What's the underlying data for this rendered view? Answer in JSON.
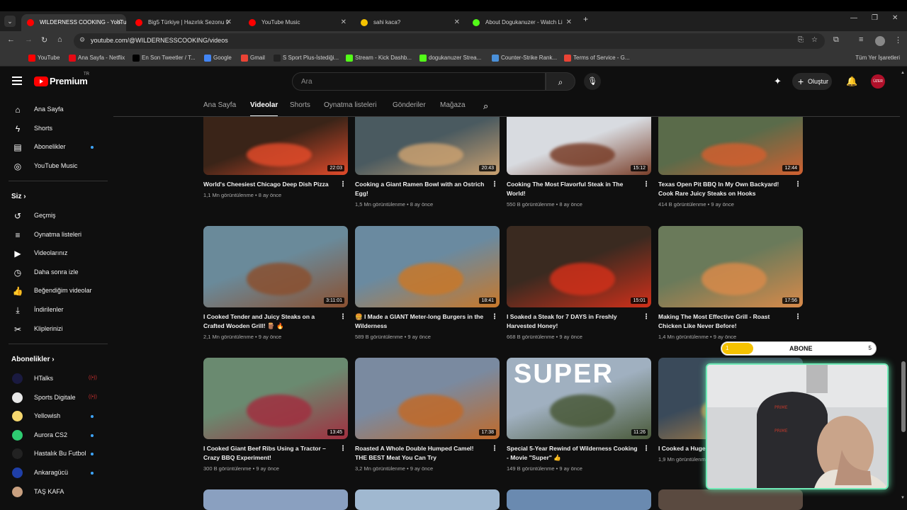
{
  "browser": {
    "tabs": [
      {
        "title": "WILDERNESS COOKING - YouTube",
        "color": "#ff0000",
        "active": true
      },
      {
        "title": "Big5 Türkiye | Hazırlık Sezonu 9",
        "color": "#ff0000",
        "active": false
      },
      {
        "title": "YouTube Music",
        "color": "#ff0000",
        "active": false
      },
      {
        "title": "sahi kaca?",
        "color": "#f5c200",
        "active": false
      },
      {
        "title": "About Dogukanuzer - Watch Li",
        "color": "#53fc18",
        "active": false
      }
    ],
    "url": "youtube.com/@WILDERNESSCOOKING/videos",
    "bookmarks": [
      {
        "label": "YouTube",
        "color": "#ff0000"
      },
      {
        "label": "Ana Sayfa - Netflix",
        "color": "#e50914"
      },
      {
        "label": "En Son Tweetler / T...",
        "color": "#000000"
      },
      {
        "label": "Google",
        "color": "#4285f4"
      },
      {
        "label": "Gmail",
        "color": "#ea4335"
      },
      {
        "label": "S Sport Plus-İstediği...",
        "color": "#222222"
      },
      {
        "label": "Stream - Kick Dashb...",
        "color": "#53fc18"
      },
      {
        "label": "dogukanuzer Strea...",
        "color": "#53fc18"
      },
      {
        "label": "Counter-Strike Rank...",
        "color": "#4a90d9"
      },
      {
        "label": "Terms of Service - G...",
        "color": "#ea4335"
      }
    ],
    "all_bookmarks": "Tüm Yer İşaretleri"
  },
  "header": {
    "logo": "Premium",
    "logo_sup": "TR",
    "search_placeholder": "Ara",
    "create_label": "Oluştur",
    "avatar_text": "ÜZER"
  },
  "sidebar": {
    "main": [
      {
        "label": "Ana Sayfa",
        "icon": "home-icon",
        "glyph": "⌂",
        "dot": false
      },
      {
        "label": "Shorts",
        "icon": "shorts-icon",
        "glyph": "ϟ",
        "dot": false
      },
      {
        "label": "Abonelikler",
        "icon": "subscriptions-icon",
        "glyph": "▤",
        "dot": true
      },
      {
        "label": "YouTube Music",
        "icon": "music-icon",
        "glyph": "◎",
        "dot": false
      }
    ],
    "you_header": "Siz",
    "you": [
      {
        "label": "Geçmiş",
        "icon": "history-icon",
        "glyph": "↺"
      },
      {
        "label": "Oynatma listeleri",
        "icon": "playlists-icon",
        "glyph": "≡"
      },
      {
        "label": "Videolarınız",
        "icon": "your-videos-icon",
        "glyph": "▶"
      },
      {
        "label": "Daha sonra izle",
        "icon": "watch-later-icon",
        "glyph": "◷"
      },
      {
        "label": "Beğendiğim videolar",
        "icon": "liked-icon",
        "glyph": "👍"
      },
      {
        "label": "İndirilenler",
        "icon": "downloads-icon",
        "glyph": "⤓"
      },
      {
        "label": "Kliplerinizi",
        "icon": "clips-icon",
        "glyph": "✂"
      }
    ],
    "subs_header": "Abonelikler",
    "subs": [
      {
        "label": "HTalks",
        "color": "#1a1a40",
        "status": "live"
      },
      {
        "label": "Sports Digitale",
        "color": "#e8e8e8",
        "status": "live"
      },
      {
        "label": "Yellowish",
        "color": "#f5d76e",
        "status": "dot"
      },
      {
        "label": "Aurora CS2",
        "color": "#2ecc71",
        "status": "dot"
      },
      {
        "label": "Hastalık Bu Futbol",
        "color": "#222222",
        "status": "dot"
      },
      {
        "label": "Ankaragücü",
        "color": "#1f3fa8",
        "status": "dot"
      },
      {
        "label": "TAŞ KAFA",
        "color": "#c8a080",
        "status": "none"
      }
    ]
  },
  "channel_tabs": [
    "Ana Sayfa",
    "Videolar",
    "Shorts",
    "Oynatma listeleri",
    "Gönderiler",
    "Mağaza"
  ],
  "active_tab": "Videolar",
  "videos": [
    {
      "title": "World's Cheesiest Chicago Deep Dish Pizza",
      "views": "1,1 Mn görüntülenme",
      "age": "8 ay önce",
      "duration": "22:03",
      "c1": "#3a2418",
      "c2": "#e04a2a"
    },
    {
      "title": "Cooking a Giant Ramen Bowl with an Ostrich Egg!",
      "views": "1,5 Mn görüntülenme",
      "age": "8 ay önce",
      "duration": "20:43",
      "c1": "#4a5a60",
      "c2": "#c9a070"
    },
    {
      "title": "Cooking The Most Flavorful Steak in The World!",
      "views": "550 B görüntülenme",
      "age": "8 ay önce",
      "duration": "15:12",
      "c1": "#d8dbe0",
      "c2": "#7a3f2a"
    },
    {
      "title": "Texas Open Pit BBQ In My Own Backyard! Cook Rare Juicy Steaks on Hooks",
      "views": "414 B görüntülenme",
      "age": "9 ay önce",
      "duration": "12:44",
      "c1": "#5a6b4a",
      "c2": "#d06030"
    },
    {
      "title": "I Cooked Tender and Juicy Steaks on a Crafted Wooden Grill! 🪵 🔥",
      "views": "2,1 Mn görüntülenme",
      "age": "9 ay önce",
      "duration": "3:11:01",
      "c1": "#6a8a9a",
      "c2": "#8a5030"
    },
    {
      "title": "🍔 I Made a GIANT Meter-long Burgers in the Wilderness",
      "views": "589 B görüntülenme",
      "age": "9 ay önce",
      "duration": "18:41",
      "c1": "#6a8aa0",
      "c2": "#c8782a"
    },
    {
      "title": "I Soaked a Steak for 7 DAYS in Freshly Harvested Honey!",
      "views": "668 B görüntülenme",
      "age": "9 ay önce",
      "duration": "15:01",
      "c1": "#3a2a20",
      "c2": "#d0301a"
    },
    {
      "title": "Making The Most Effective Grill - Roast Chicken Like Never Before!",
      "views": "1,4 Mn görüntülenme",
      "age": "9 ay önce",
      "duration": "17:56",
      "c1": "#6a7a5a",
      "c2": "#d88a4a"
    },
    {
      "title": "I Cooked Giant Beef Ribs Using a Tractor – Crazy BBQ Experiment!",
      "views": "300 B görüntülenme",
      "age": "9 ay önce",
      "duration": "13:45",
      "c1": "#6a8a70",
      "c2": "#a03040"
    },
    {
      "title": "Roasted A Whole Double Humped Camel! THE BEST Meat You Can Try",
      "views": "3,2 Mn görüntülenme",
      "age": "9 ay önce",
      "duration": "17:38",
      "c1": "#7a8aa0",
      "c2": "#c06a2a"
    },
    {
      "title": "Special 5-Year Rewind of Wilderness Cooking - Movie \"Super\" 👍",
      "views": "149 B görüntülenme",
      "age": "9 ay önce",
      "duration": "11:26",
      "c1": "#a0b0c0",
      "c2": "#4a5a3a",
      "overlay": "SUPER"
    },
    {
      "title": "I Cooked a Huge",
      "views": "1,9 Mn görüntülenme",
      "age": "",
      "duration": "",
      "c1": "#3a4a5a",
      "c2": "#d09040"
    }
  ],
  "next_row_colors": [
    "#8aa0c0",
    "#a0b8d0",
    "#6a8ab0",
    "#5a4a40"
  ],
  "overlay": {
    "goal_label": "ABONE",
    "current": "1",
    "target": "5",
    "progress_fraction": 0.2,
    "bar_color": "#f5c200",
    "webcam_border": "#6fe9b6"
  }
}
